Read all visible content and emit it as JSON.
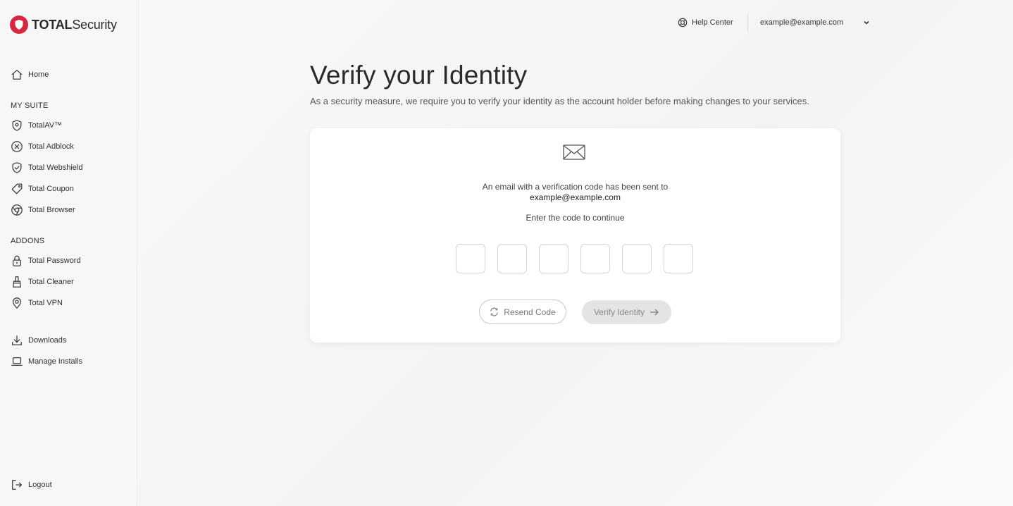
{
  "brand": {
    "bold": "TOTAL",
    "regular": "Security",
    "color": "#d7263d"
  },
  "sidebar": {
    "home": {
      "label": "Home",
      "icon": "home-icon"
    },
    "my_suite_label": "MY SUITE",
    "suite": [
      {
        "label": "TotalAV™",
        "icon": "shield-pin-icon"
      },
      {
        "label": "Total Adblock",
        "icon": "x-circle-icon"
      },
      {
        "label": "Total Webshield",
        "icon": "shield-check-icon"
      },
      {
        "label": "Total Coupon",
        "icon": "tag-icon"
      },
      {
        "label": "Total Browser",
        "icon": "browser-icon"
      }
    ],
    "addons_label": "ADDONS",
    "addons": [
      {
        "label": "Total Password",
        "icon": "lock-icon"
      },
      {
        "label": "Total Cleaner",
        "icon": "cleaner-icon"
      },
      {
        "label": "Total VPN",
        "icon": "location-pin-icon"
      }
    ],
    "downloads": {
      "label": "Downloads",
      "icon": "download-icon"
    },
    "manage_installs": {
      "label": "Manage Installs",
      "icon": "laptop-icon"
    },
    "logout": {
      "label": "Logout",
      "icon": "logout-icon"
    }
  },
  "topbar": {
    "help_center": "Help Center",
    "account_email": "example@example.com"
  },
  "page": {
    "title": "Verify your Identity",
    "description": "As a security measure, we require you to verify your identity as the account holder before making changes to your services."
  },
  "card": {
    "message": "An email with a verification code has been sent to",
    "email": "example@example.com",
    "enter_prompt": "Enter the code to continue",
    "code_digits": [
      "",
      "",
      "",
      "",
      "",
      ""
    ],
    "resend_label": "Resend Code",
    "verify_label": "Verify Identity"
  }
}
